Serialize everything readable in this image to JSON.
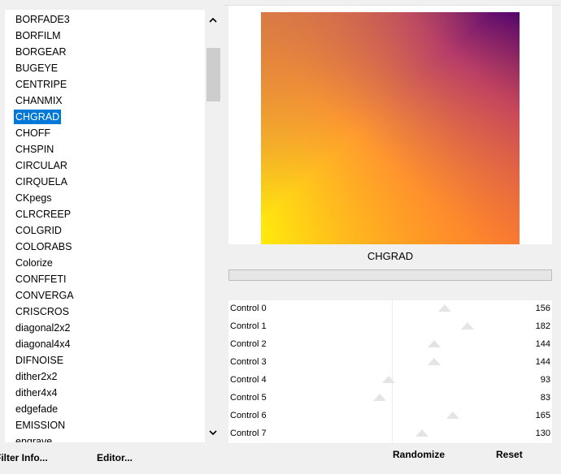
{
  "filter_list": {
    "items": [
      "BORFADE3",
      "BORFILM",
      "BORGEAR",
      "BUGEYE",
      "CENTRIPE",
      "CHANMIX",
      "CHGRAD",
      "CHOFF",
      "CHSPIN",
      "CIRCULAR",
      "CIRQUELA",
      "CKpegs",
      "CLRCREEP",
      "COLGRID",
      "COLORABS",
      "Colorize",
      "CONFFETI",
      "CONVERGA",
      "CRISCROS",
      "diagonal2x2",
      "diagonal4x4",
      "DIFNOISE",
      "dither2x2",
      "dither4x4",
      "edgefade",
      "EMISSION",
      "engrave"
    ],
    "selected": "CHGRAD"
  },
  "footer": {
    "filter_info_label": "Filter Info...",
    "editor_label": "Editor..."
  },
  "preview": {
    "filter_name": "CHGRAD",
    "gradient_colors": [
      "#fff20a",
      "#ff9c2e",
      "#b53b6a",
      "#4a006e"
    ]
  },
  "controls": [
    {
      "label": "Control 0",
      "value": "156",
      "level": 156
    },
    {
      "label": "Control 1",
      "value": "182",
      "level": 182
    },
    {
      "label": "Control 2",
      "value": "144",
      "level": 144
    },
    {
      "label": "Control 3",
      "value": "144",
      "level": 144
    },
    {
      "label": "Control 4",
      "value": "93",
      "level": 93
    },
    {
      "label": "Control 5",
      "value": "83",
      "level": 83
    },
    {
      "label": "Control 6",
      "value": "165",
      "level": 165
    },
    {
      "label": "Control 7",
      "value": "130",
      "level": 130
    }
  ],
  "buttons": {
    "randomize_label": "Randomize",
    "reset_label": "Reset"
  },
  "icons": {
    "scroll_up": "chevron-up-icon",
    "scroll_down": "chevron-down-icon"
  },
  "colors": {
    "selection": "#0078d7"
  }
}
